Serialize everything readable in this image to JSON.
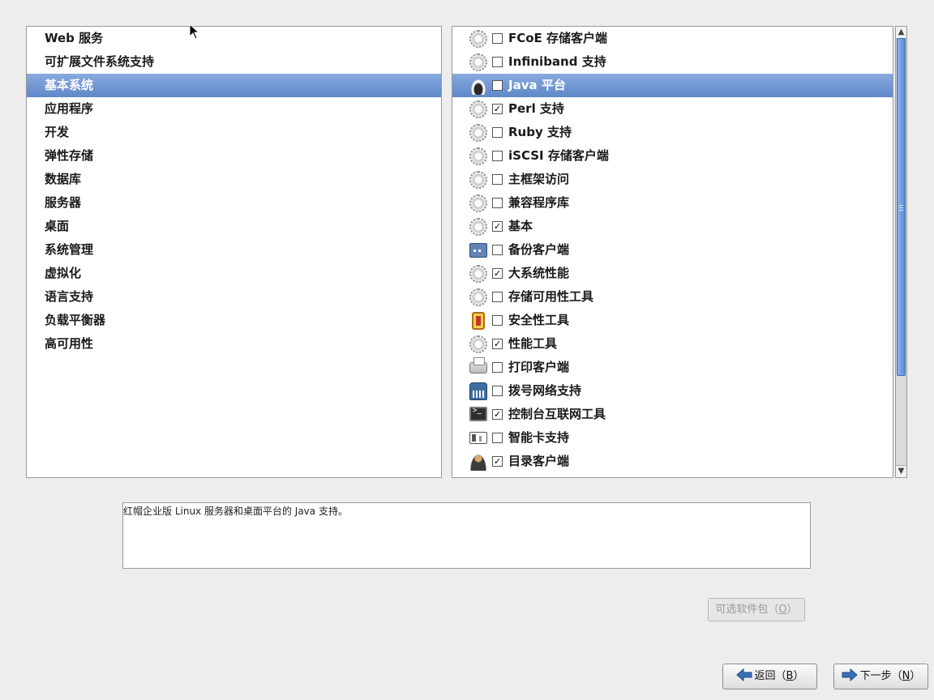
{
  "categories": {
    "items": [
      {
        "label": "Web 服务",
        "selected": false
      },
      {
        "label": "可扩展文件系统支持",
        "selected": false
      },
      {
        "label": "基本系统",
        "selected": true
      },
      {
        "label": "应用程序",
        "selected": false
      },
      {
        "label": "开发",
        "selected": false
      },
      {
        "label": "弹性存储",
        "selected": false
      },
      {
        "label": "数据库",
        "selected": false
      },
      {
        "label": "服务器",
        "selected": false
      },
      {
        "label": "桌面",
        "selected": false
      },
      {
        "label": "系统管理",
        "selected": false
      },
      {
        "label": "虚拟化",
        "selected": false
      },
      {
        "label": "语言支持",
        "selected": false
      },
      {
        "label": "负载平衡器",
        "selected": false
      },
      {
        "label": "高可用性",
        "selected": false
      }
    ]
  },
  "groups": {
    "items": [
      {
        "label": "FCoE 存储客户端",
        "checked": false,
        "icon": "gear-icon",
        "selected": false
      },
      {
        "label": "Infiniband 支持",
        "checked": false,
        "icon": "gear-icon",
        "selected": false
      },
      {
        "label": "Java 平台",
        "checked": false,
        "icon": "coffee-cup-icon",
        "selected": true
      },
      {
        "label": "Perl 支持",
        "checked": true,
        "icon": "gear-icon",
        "selected": false
      },
      {
        "label": "Ruby 支持",
        "checked": false,
        "icon": "gear-icon",
        "selected": false
      },
      {
        "label": "iSCSI 存储客户端",
        "checked": false,
        "icon": "gear-icon",
        "selected": false
      },
      {
        "label": "主框架访问",
        "checked": false,
        "icon": "gear-icon",
        "selected": false
      },
      {
        "label": "兼容程序库",
        "checked": false,
        "icon": "gear-icon",
        "selected": false
      },
      {
        "label": "基本",
        "checked": true,
        "icon": "gear-icon",
        "selected": false
      },
      {
        "label": "备份客户端",
        "checked": false,
        "icon": "backup-drive-icon",
        "selected": false
      },
      {
        "label": "大系统性能",
        "checked": true,
        "icon": "gear-icon",
        "selected": false
      },
      {
        "label": "存储可用性工具",
        "checked": false,
        "icon": "gear-icon",
        "selected": false
      },
      {
        "label": "安全性工具",
        "checked": false,
        "icon": "security-shield-icon",
        "selected": false
      },
      {
        "label": "性能工具",
        "checked": true,
        "icon": "gear-icon",
        "selected": false
      },
      {
        "label": "打印客户端",
        "checked": false,
        "icon": "printer-icon",
        "selected": false
      },
      {
        "label": "拨号网络支持",
        "checked": false,
        "icon": "phone-icon",
        "selected": false
      },
      {
        "label": "控制台互联网工具",
        "checked": true,
        "icon": "terminal-icon",
        "selected": false
      },
      {
        "label": "智能卡支持",
        "checked": false,
        "icon": "smart-card-icon",
        "selected": false
      },
      {
        "label": "目录客户端",
        "checked": true,
        "icon": "users-icon",
        "selected": false
      }
    ],
    "check_glyph": "✓"
  },
  "scrollbar": {
    "up_glyph": "▲",
    "down_glyph": "▼",
    "visible_fraction": 0.79,
    "scroll_position": 0.0
  },
  "description": {
    "text": "红帽企业版 Linux 服务器和桌面平台的 Java 支持。"
  },
  "buttons": {
    "optional_label": "可选软件包（",
    "optional_mnemonic": "O",
    "optional_suffix": "）",
    "back_label": "返回（",
    "back_mnemonic": "B",
    "back_suffix": "）",
    "next_label": "下一步（",
    "next_mnemonic": "N",
    "next_suffix": "）"
  },
  "colors": {
    "selection": "#6e94d1",
    "accent_arrow": "#3a6fb8"
  }
}
